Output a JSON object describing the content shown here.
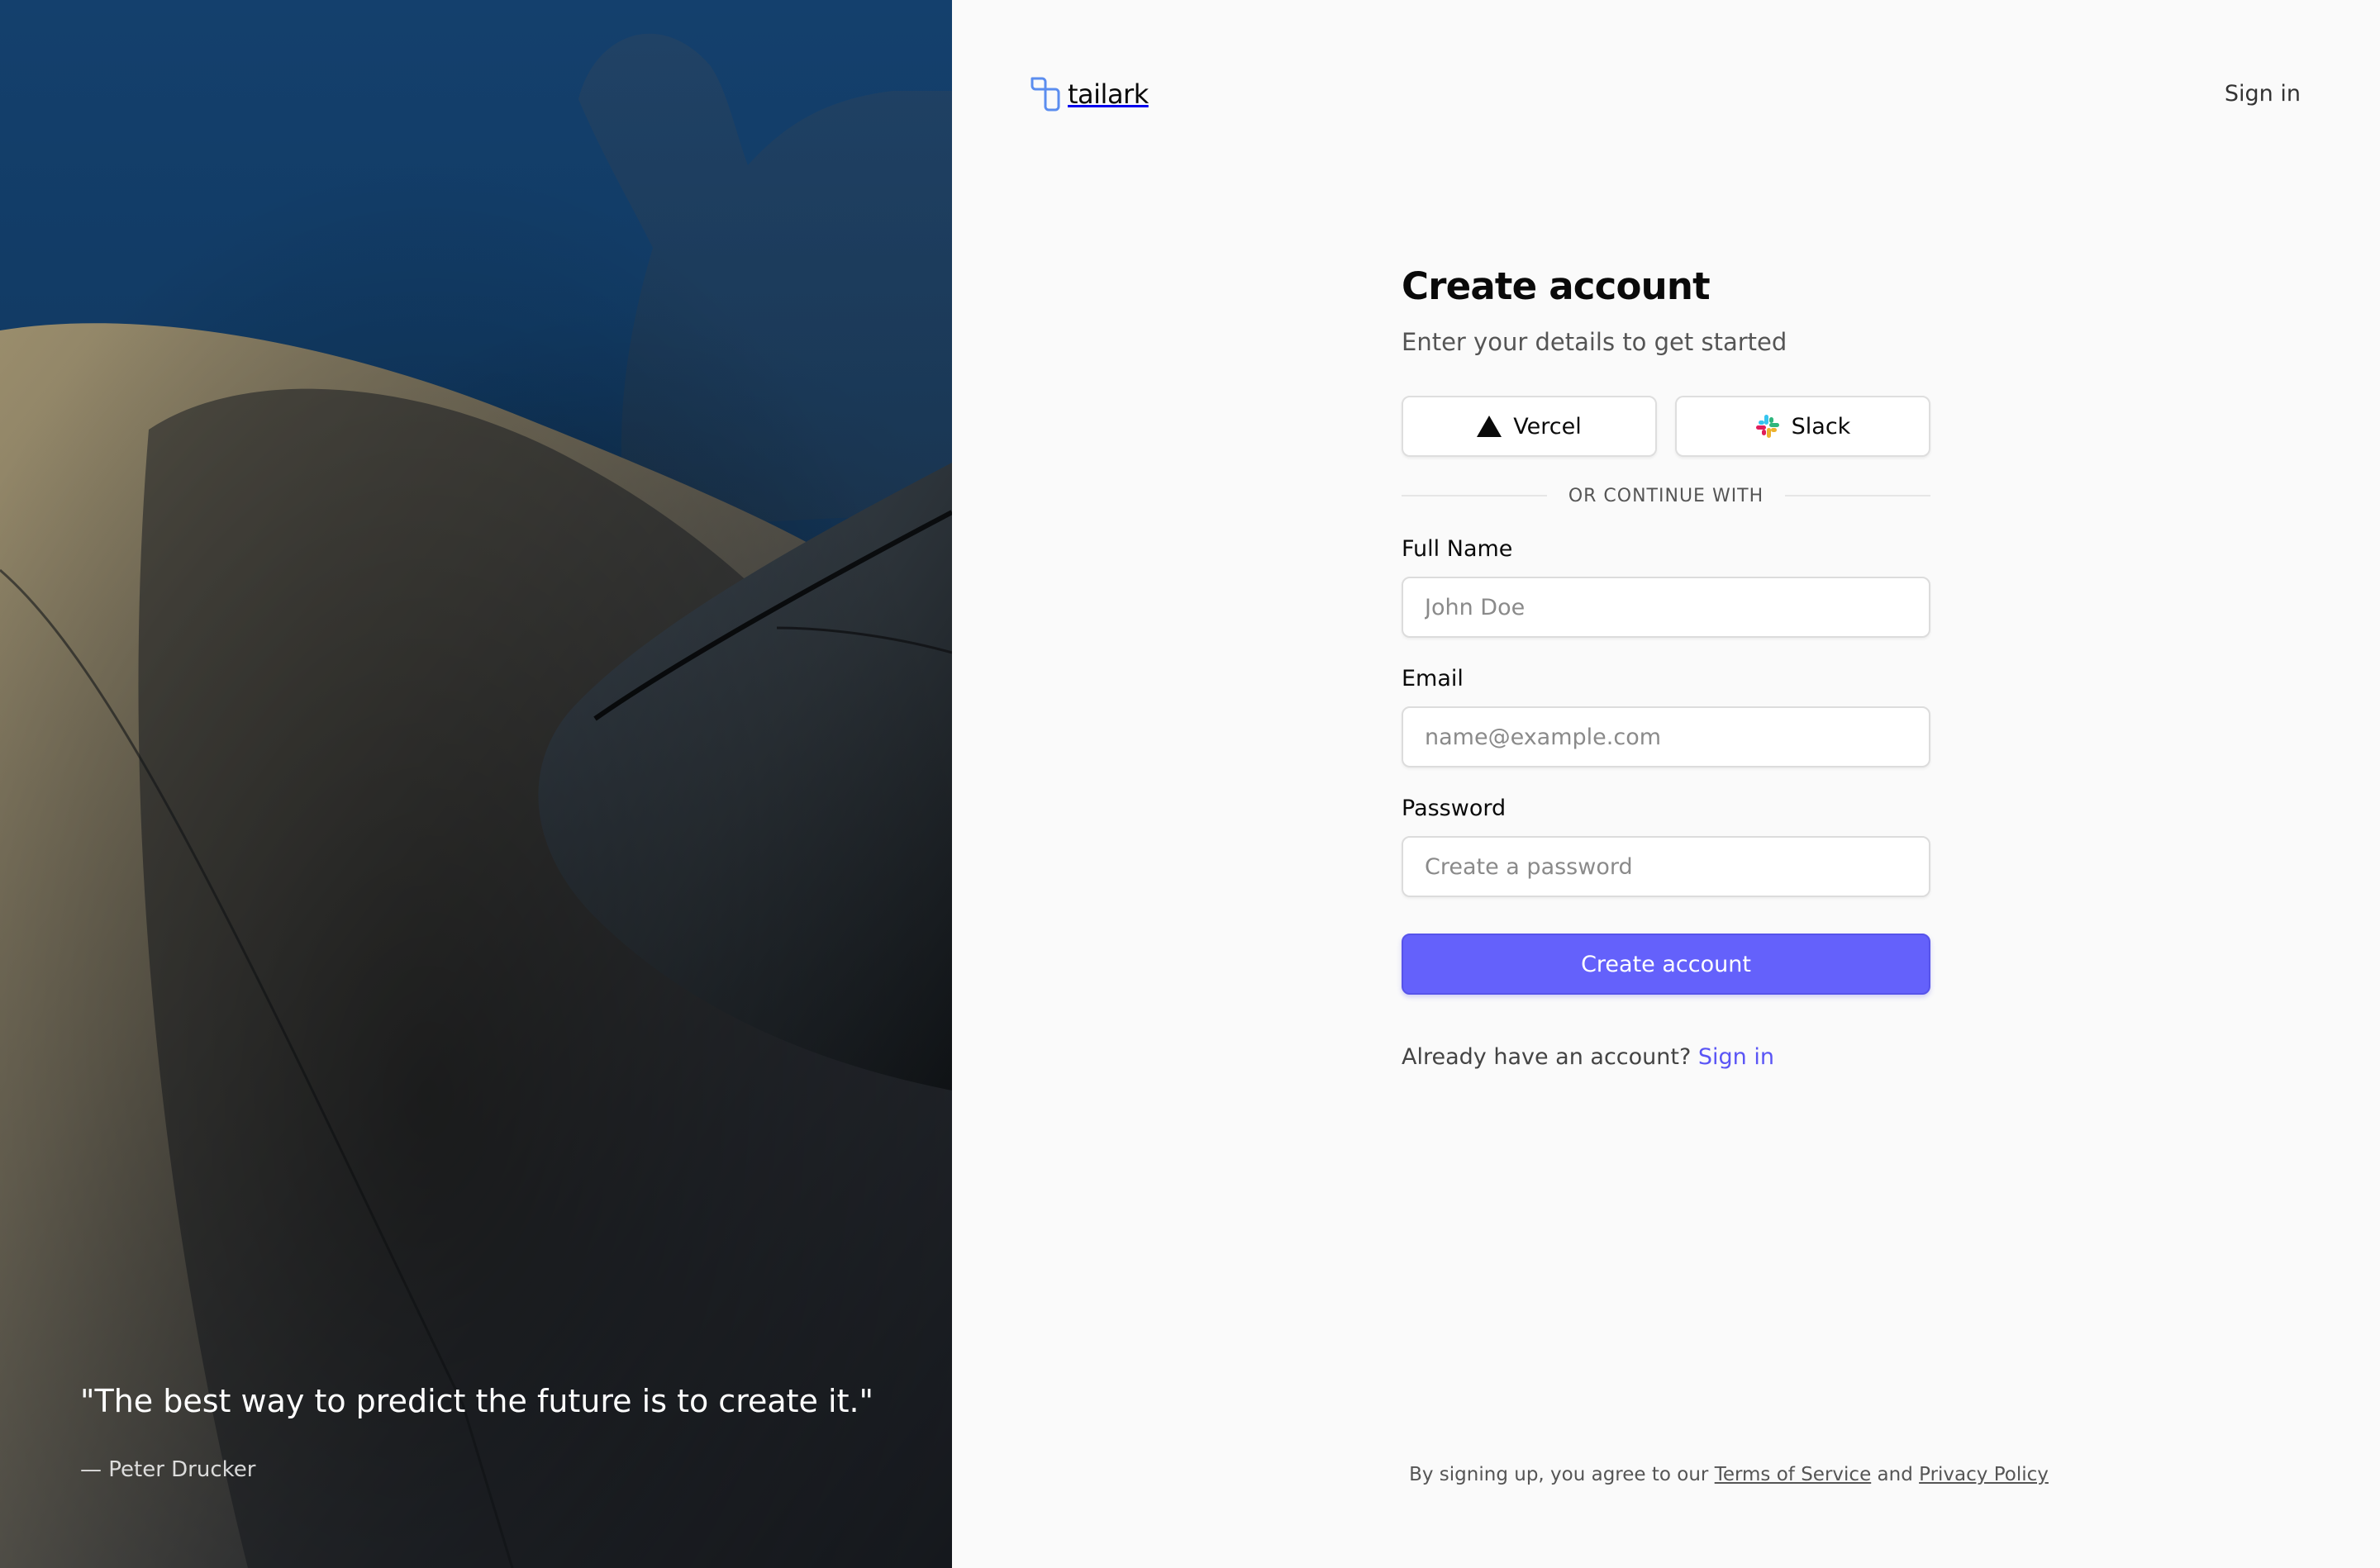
{
  "hero": {
    "quote": "\"The best way to predict the future is to create it.\"",
    "author": "— Peter Drucker"
  },
  "header": {
    "brand": "tailark",
    "signin_link": "Sign in"
  },
  "form": {
    "title": "Create account",
    "subtitle": "Enter your details to get started",
    "oauth": {
      "vercel_label": "Vercel",
      "slack_label": "Slack"
    },
    "divider_text": "OR CONTINUE WITH",
    "full_name": {
      "label": "Full Name",
      "placeholder": "John Doe",
      "value": ""
    },
    "email": {
      "label": "Email",
      "placeholder": "name@example.com",
      "value": ""
    },
    "password": {
      "label": "Password",
      "placeholder": "Create a password",
      "value": ""
    },
    "submit_label": "Create account",
    "already_text": "Already have an account?",
    "already_link": "Sign in"
  },
  "footer": {
    "prefix": "By signing up, you agree to our",
    "terms": "Terms of Service",
    "and": "and",
    "privacy": "Privacy Policy"
  },
  "colors": {
    "accent": "#6461fb",
    "link": "#5a55f5",
    "background": "#fafafa",
    "hero_sky": "#14406d"
  },
  "icons": {
    "logo": "tailark-logo-icon",
    "vercel": "vercel-triangle-icon",
    "slack": "slack-icon"
  }
}
